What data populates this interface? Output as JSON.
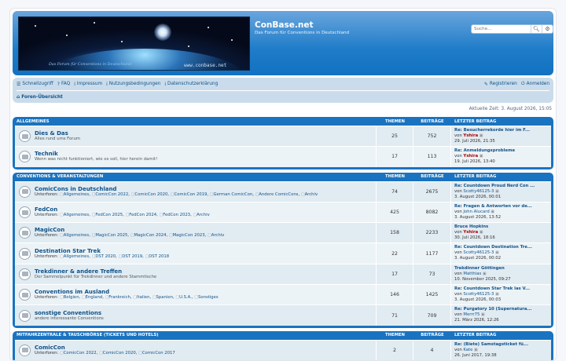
{
  "site": {
    "title": "ConBase.net",
    "description": "Das Forum für Conventions in Deutschland",
    "banner_tagline": "Das Forum für Conventions in Deutschland",
    "banner_url": "www.conbase.net",
    "search_placeholder": "Suche..."
  },
  "nav": {
    "left": [
      {
        "label": "Schnellzugriff",
        "icon": "menu-icon"
      },
      {
        "label": "FAQ",
        "icon": "help-icon"
      },
      {
        "label": "Impressum",
        "icon": "info-icon"
      },
      {
        "label": "Nutzungsbedingungen",
        "icon": "info-icon"
      },
      {
        "label": "Datenschutzerklärung",
        "icon": "info-icon"
      }
    ],
    "right": [
      {
        "label": "Registrieren",
        "icon": "register-icon"
      },
      {
        "label": "Anmelden",
        "icon": "power-icon"
      }
    ],
    "breadcrumb": "Foren-Übersicht"
  },
  "current_time": "Aktuelle Zeit: 3. August 2026, 15:05",
  "columns": {
    "themen": "THEMEN",
    "beitraege": "BEITRÄGE",
    "letzter": "LETZTER BEITRAG"
  },
  "categories": [
    {
      "name": "ALLGEMEINES",
      "forums": [
        {
          "title": "Dies & Das",
          "desc": "Alles rund ums Forum",
          "subs": [],
          "themen": "25",
          "beitraege": "752",
          "last_title": "Re: Besucherrekorde hier im F...",
          "last_by": "von",
          "last_author": "Yshira",
          "author_red": true,
          "last_date": "29. Juli 2026, 21:35"
        },
        {
          "title": "Technik",
          "desc": "Wenn was nicht funktioniert, wie es soll, hier herein damit!",
          "subs": [],
          "themen": "17",
          "beitraege": "113",
          "last_title": "Re: Anmeldungsprobleme",
          "last_by": "von",
          "last_author": "Yshira",
          "author_red": true,
          "last_date": "19. Juli 2026, 13:40"
        }
      ]
    },
    {
      "name": "CONVENTIONS & VERANSTALTUNGEN",
      "forums": [
        {
          "title": "ComicCons in Deutschland",
          "desc": "",
          "subs_label": "Unterforen:",
          "subs": [
            "Allgemeines",
            "ComicCon 2022",
            "ComicCon 2020",
            "ComicCon 2019",
            "German ComicCon",
            "Andere ComicCons",
            "Archiv"
          ],
          "themen": "74",
          "beitraege": "2675",
          "last_title": "Re: Countdown Proud Nerd Con ...",
          "last_by": "von",
          "last_author": "Scotty46125-3",
          "author_red": false,
          "last_date": "3. August 2026, 00:01"
        },
        {
          "title": "FedCon",
          "desc": "",
          "subs_label": "Unterforen:",
          "subs": [
            "Allgemeines",
            "FedCon 2025",
            "FedCon 2024",
            "FedCon 2023",
            "Archiv"
          ],
          "themen": "425",
          "beitraege": "8082",
          "last_title": "Re: Fragen & Antworten vor de...",
          "last_by": "von",
          "last_author": "John Alucard",
          "author_red": false,
          "last_date": "3. August 2026, 13:52"
        },
        {
          "title": "MagicCon",
          "desc": "",
          "subs_label": "Unterforen:",
          "subs": [
            "Allgemeines",
            "MagicCon 2025",
            "MagicCon 2024",
            "MagicCon 2023",
            "Archiv"
          ],
          "themen": "158",
          "beitraege": "2233",
          "last_title": "Bruce Hopkins",
          "last_by": "von",
          "last_author": "Yshira",
          "author_red": true,
          "last_date": "30. Juli 2026, 18:16"
        },
        {
          "title": "Destination Star Trek",
          "desc": "",
          "subs_label": "Unterforen:",
          "subs": [
            "Allgemeines",
            "DST 2020",
            "DST 2019",
            "DST 2018"
          ],
          "themen": "22",
          "beitraege": "1177",
          "last_title": "Re: Countdown Destination Tre...",
          "last_by": "von",
          "last_author": "Scotty46125-3",
          "author_red": false,
          "last_date": "3. August 2026, 00:02"
        },
        {
          "title": "Trekdinner & andere Treffen",
          "desc": "Der Sammelpunkt für Trekdinner und andere Stammtische",
          "subs": [],
          "themen": "17",
          "beitraege": "73",
          "last_title": "Trekdinner Göttingen",
          "last_by": "von",
          "last_author": "Matthias",
          "author_red": false,
          "last_date": "10. November 2025, 09:27"
        },
        {
          "title": "Conventions im Ausland",
          "desc": "",
          "subs_label": "Unterforen:",
          "subs": [
            "Belgien",
            "England",
            "Frankreich",
            "Italien",
            "Spanien",
            "U.S.A.",
            "Sonstiges"
          ],
          "themen": "146",
          "beitraege": "1425",
          "last_title": "Re: Countdown Star Trek las V...",
          "last_by": "von",
          "last_author": "Scotty46125-3",
          "author_red": false,
          "last_date": "3. August 2026, 00:03"
        },
        {
          "title": "sonstige Conventions",
          "desc": "andere interessante Conventions",
          "subs": [],
          "themen": "71",
          "beitraege": "709",
          "last_title": "Re: Purgatory 10 (Supernatura...",
          "last_by": "von",
          "last_author": "Merrr75",
          "author_red": false,
          "last_date": "21. März 2026, 12:26"
        }
      ]
    },
    {
      "name": "MITFAHRZENTRALE & TAUSCHBÖRSE (TICKETS UND HOTELS)",
      "forums": [
        {
          "title": "ComicCon",
          "desc": "",
          "subs_label": "Unterforen:",
          "subs": [
            "ComicCon 2022",
            "ComicCon 2020",
            "ComicCon 2017"
          ],
          "themen": "2",
          "beitraege": "4",
          "last_title": "Re: (Biete) Samstagsticket fü...",
          "last_by": "von",
          "last_author": "Kate",
          "author_red": false,
          "last_date": "26. Juni 2017, 19:38"
        }
      ]
    }
  ],
  "colors": {
    "header_blue": "#1a73c0",
    "link": "#105289",
    "admin_red": "#aa0000",
    "row_light": "#ecf3f7",
    "row_dark": "#e1ebf2"
  }
}
